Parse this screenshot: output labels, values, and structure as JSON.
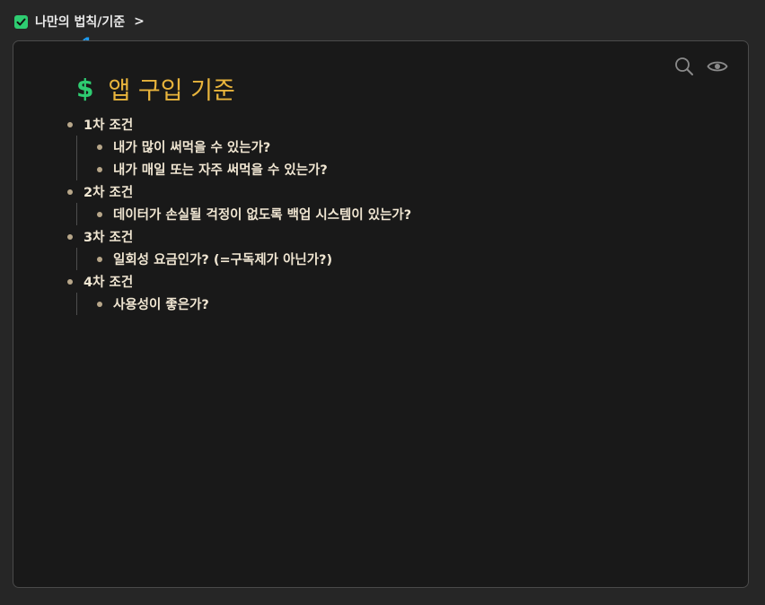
{
  "breadcrumb": {
    "title": "나만의 법칙/기준",
    "separator": ">"
  },
  "page": {
    "icon": "$",
    "title": "앱 구입 기준"
  },
  "markers": [
    "1",
    "2",
    "3",
    "4"
  ],
  "outline": [
    {
      "label": "1차 조건",
      "children": [
        "내가 많이 써먹을 수 있는가?",
        "내가 매일 또는 자주 써먹을 수 있는가?"
      ]
    },
    {
      "label": "2차 조건",
      "children": [
        "데이터가 손실될 걱정이 없도록 백업 시스템이 있는가?"
      ]
    },
    {
      "label": "3차 조건",
      "children": [
        "일회성 요금인가? (=구독제가 아닌가?)"
      ]
    },
    {
      "label": "4차 조건",
      "children": [
        "사용성이 좋은가?"
      ]
    }
  ],
  "toolbar": {
    "icons": [
      "search-icon",
      "eye-icon"
    ]
  },
  "colors": {
    "accent_green": "#2ecc71",
    "title_gold": "#e8b43c",
    "marker_blue": "#1d9bf0",
    "card_bg": "#191919"
  }
}
